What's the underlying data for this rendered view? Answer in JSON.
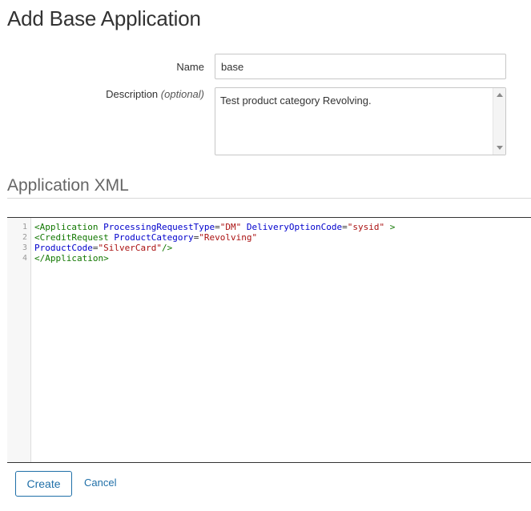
{
  "page": {
    "title": "Add Base Application"
  },
  "form": {
    "name_label": "Name",
    "name_value": "base",
    "description_label": "Description",
    "description_optional": "(optional)",
    "description_value": "Test product category Revolving."
  },
  "section": {
    "title": "Application XML"
  },
  "editor": {
    "line_numbers": [
      "1",
      "2",
      "3",
      "4"
    ],
    "lines": [
      [
        {
          "text": "<Application ",
          "type": "tag"
        },
        {
          "text": "ProcessingRequestType",
          "type": "attr"
        },
        {
          "text": "=",
          "type": "plain"
        },
        {
          "text": "\"DM\"",
          "type": "str"
        },
        {
          "text": " ",
          "type": "plain"
        },
        {
          "text": "DeliveryOptionCode",
          "type": "attr"
        },
        {
          "text": "=",
          "type": "plain"
        },
        {
          "text": "\"sysid\"",
          "type": "str"
        },
        {
          "text": " >",
          "type": "tag"
        }
      ],
      [
        {
          "text": "<CreditRequest ",
          "type": "tag"
        },
        {
          "text": "ProductCategory",
          "type": "attr"
        },
        {
          "text": "=",
          "type": "plain"
        },
        {
          "text": "\"Revolving\"",
          "type": "str"
        }
      ],
      [
        {
          "text": "ProductCode",
          "type": "attr"
        },
        {
          "text": "=",
          "type": "plain"
        },
        {
          "text": "\"SilverCard\"",
          "type": "str"
        },
        {
          "text": "/>",
          "type": "tag"
        }
      ],
      [
        {
          "text": "</Application>",
          "type": "tag"
        }
      ]
    ]
  },
  "actions": {
    "create_label": "Create",
    "cancel_label": "Cancel"
  },
  "colors": {
    "accent": "#1f6fa8",
    "xml_tag": "#117700",
    "xml_attr": "#0000cc",
    "xml_string": "#aa1111"
  }
}
